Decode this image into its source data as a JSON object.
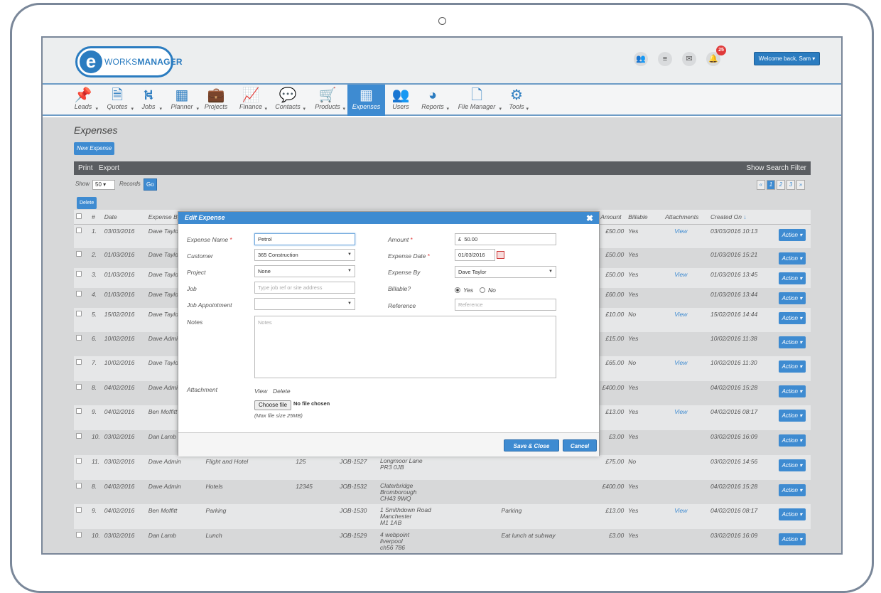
{
  "header": {
    "logo_letter": "e",
    "logo_text_a": "WORKS",
    "logo_text_b": "MANAGER",
    "notification_count": "25",
    "welcome": "Welcome back, Sam",
    "icons": [
      "users-icon",
      "server-icon",
      "mail-icon",
      "bell-icon"
    ]
  },
  "nav": [
    {
      "label": "Leads",
      "icon": "pin-icon",
      "glyph": "📌",
      "caret": true
    },
    {
      "label": "Quotes",
      "icon": "document-icon",
      "glyph": "🗎",
      "caret": true
    },
    {
      "label": "Jobs",
      "icon": "road-icon",
      "glyph": "⛕",
      "caret": true
    },
    {
      "label": "Planner",
      "icon": "calendar-icon",
      "glyph": "▦",
      "caret": true
    },
    {
      "label": "Projects",
      "icon": "briefcase-icon",
      "glyph": "💼",
      "caret": false
    },
    {
      "label": "Finance",
      "icon": "chart-icon",
      "glyph": "📈",
      "caret": true
    },
    {
      "label": "Contacts",
      "icon": "chat-icon",
      "glyph": "💬",
      "caret": true
    },
    {
      "label": "Products",
      "icon": "cart-icon",
      "glyph": "🛒",
      "caret": true
    },
    {
      "label": "Expenses",
      "icon": "calculator-icon",
      "glyph": "▦",
      "caret": false,
      "active": true
    },
    {
      "label": "Users",
      "icon": "group-icon",
      "glyph": "👥",
      "caret": false
    },
    {
      "label": "Reports",
      "icon": "pie-icon",
      "glyph": "◕",
      "caret": true
    },
    {
      "label": "File Manager",
      "icon": "pdf-icon",
      "glyph": "🗋",
      "caret": true
    },
    {
      "label": "Tools",
      "icon": "cogs-icon",
      "glyph": "⚙",
      "caret": true
    }
  ],
  "page": {
    "title": "Expenses",
    "new_button": "New Expense",
    "print": "Print",
    "export": "Export",
    "search_filter": "Show Search Filter",
    "show_label": "Show",
    "show_value": "50",
    "records_label": "Records",
    "go": "Go",
    "pages": [
      "1",
      "2",
      "3"
    ],
    "delete": "Delete"
  },
  "table": {
    "headers": {
      "num": "#",
      "date": "Date",
      "expense_by": "Expense By",
      "amount": "Amount",
      "billable": "Billable",
      "attachments": "Attachments",
      "created_on": "Created On"
    },
    "rows": [
      {
        "n": "1.",
        "date": "03/03/2016",
        "by": "Dave Taylor",
        "type": "",
        "ref": "",
        "job": "",
        "addr": [],
        "notes": "",
        "amount": "£50.00",
        "billable": "Yes",
        "att": "View",
        "created": "03/03/2016 10:13"
      },
      {
        "n": "2.",
        "date": "01/03/2016",
        "by": "Dave Taylor",
        "type": "",
        "ref": "",
        "job": "",
        "addr": [],
        "notes": "",
        "amount": "£50.00",
        "billable": "Yes",
        "att": "",
        "created": "01/03/2016 15:21"
      },
      {
        "n": "3.",
        "date": "01/03/2016",
        "by": "Dave Taylor",
        "type": "",
        "ref": "",
        "job": "",
        "addr": [],
        "notes": "",
        "amount": "£50.00",
        "billable": "Yes",
        "att": "View",
        "created": "01/03/2016 13:45"
      },
      {
        "n": "4.",
        "date": "01/03/2016",
        "by": "Dave Taylor",
        "type": "",
        "ref": "",
        "job": "",
        "addr": [],
        "notes": "",
        "amount": "£60.00",
        "billable": "Yes",
        "att": "",
        "created": "01/03/2016 13:44"
      },
      {
        "n": "5.",
        "date": "15/02/2016",
        "by": "Dave Taylor",
        "type": "",
        "ref": "",
        "job": "",
        "addr": [],
        "notes": "",
        "amount": "£10.00",
        "billable": "No",
        "att": "View",
        "created": "15/02/2016 14:44"
      },
      {
        "n": "6.",
        "date": "10/02/2016",
        "by": "Dave Admin",
        "type": "",
        "ref": "",
        "job": "",
        "addr": [],
        "notes": "",
        "amount": "£15.00",
        "billable": "Yes",
        "att": "",
        "created": "10/02/2016 11:38"
      },
      {
        "n": "7.",
        "date": "10/02/2016",
        "by": "Dave Taylor",
        "type": "",
        "ref": "",
        "job": "",
        "addr": [],
        "notes": "",
        "amount": "£65.00",
        "billable": "No",
        "att": "View",
        "created": "10/02/2016 11:30"
      },
      {
        "n": "8.",
        "date": "04/02/2016",
        "by": "Dave Admin",
        "type": "Hotels",
        "ref": "12345",
        "job": "JOB-1532",
        "addr": [
          "Claterbridge",
          "Bromborough",
          "CH43 9WQ"
        ],
        "notes": "",
        "amount": "£400.00",
        "billable": "Yes",
        "att": "",
        "created": "04/02/2016 15:28"
      },
      {
        "n": "9.",
        "date": "04/02/2016",
        "by": "Ben Moffitt",
        "type": "Parking",
        "ref": "",
        "job": "JOB-1530",
        "addr": [
          "1 Smithdown Road",
          "Manchester",
          "M1 1AB"
        ],
        "notes": "Parking",
        "amount": "£13.00",
        "billable": "Yes",
        "att": "View",
        "created": "04/02/2016 08:17"
      },
      {
        "n": "10.",
        "date": "03/02/2016",
        "by": "Dan Lamb",
        "type": "Lunch",
        "ref": "",
        "job": "JOB-1529",
        "addr": [
          "4 webpoint",
          "liverpool",
          "ch56 786"
        ],
        "notes": "Eat lunch at subway",
        "amount": "£3.00",
        "billable": "Yes",
        "att": "",
        "created": "03/02/2016 16:09"
      },
      {
        "n": "11.",
        "date": "03/02/2016",
        "by": "Dave Admin",
        "type": "Flight and Hotel",
        "ref": "125",
        "job": "JOB-1527",
        "addr": [
          "Longmoor Lane",
          "",
          "PR3 0JB"
        ],
        "notes": "",
        "amount": "£75.00",
        "billable": "No",
        "att": "",
        "created": "03/02/2016 14:56"
      },
      {
        "n": "8.",
        "date": "04/02/2016",
        "by": "Dave Admin",
        "type": "Hotels",
        "ref": "12345",
        "job": "JOB-1532",
        "addr": [
          "Claterbridge",
          "Bromborough",
          "CH43 9WQ"
        ],
        "notes": "",
        "amount": "£400.00",
        "billable": "Yes",
        "att": "",
        "created": "04/02/2016 15:28"
      },
      {
        "n": "9.",
        "date": "04/02/2016",
        "by": "Ben Moffitt",
        "type": "Parking",
        "ref": "",
        "job": "JOB-1530",
        "addr": [
          "1 Smithdown Road",
          "Manchester",
          "M1 1AB"
        ],
        "notes": "Parking",
        "amount": "£13.00",
        "billable": "Yes",
        "att": "View",
        "created": "04/02/2016 08:17"
      },
      {
        "n": "10.",
        "date": "03/02/2016",
        "by": "Dan Lamb",
        "type": "Lunch",
        "ref": "",
        "job": "JOB-1529",
        "addr": [
          "4 webpoint",
          "liverpool",
          "ch56 786"
        ],
        "notes": "Eat lunch at subway",
        "amount": "£3.00",
        "billable": "Yes",
        "att": "",
        "created": "03/02/2016 16:09"
      }
    ],
    "action_label": "Action"
  },
  "modal": {
    "title": "Edit Expense",
    "close": "✖",
    "expense_name_label": "Expense Name",
    "expense_name_value": "Petrol",
    "amount_label": "Amount",
    "currency": "£",
    "amount_value": "50.00",
    "customer_label": "Customer",
    "customer_value": "365 Construction",
    "expense_date_label": "Expense Date",
    "expense_date_value": "01/03/2016",
    "project_label": "Project",
    "project_value": "None",
    "expense_by_label": "Expense By",
    "expense_by_value": "Dave Taylor",
    "job_label": "Job",
    "job_placeholder": "Type job ref or site address",
    "billable_label": "Billable?",
    "billable_yes": "Yes",
    "billable_no": "No",
    "billable_selected": "Yes",
    "job_appointment_label": "Job Appointment",
    "job_appointment_value": "",
    "reference_label": "Reference",
    "reference_placeholder": "Reference",
    "notes_label": "Notes",
    "notes_placeholder": "Notes",
    "attachment_label": "Attachment",
    "view": "View",
    "delete": "Delete",
    "choose_file": "Choose file",
    "no_file": "No file chosen",
    "max_size": "(Max file size 25MB)",
    "save": "Save & Close",
    "cancel": "Cancel"
  },
  "colors": {
    "accent": "#3e8bd1",
    "header_bar": "#5a5d61",
    "badge": "#e03a3a"
  }
}
